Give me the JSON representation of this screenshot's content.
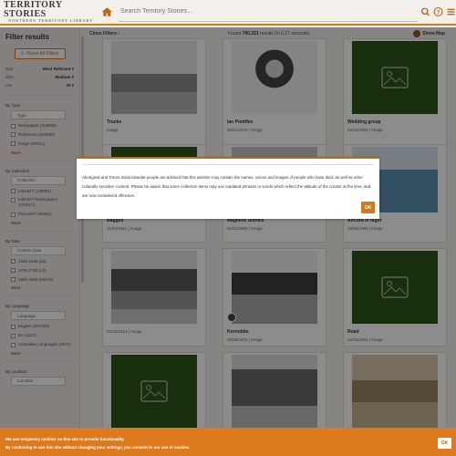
{
  "header": {
    "logo_main": "TERRITORY STORIES",
    "logo_sub": "NORTHERN TERRITORY LIBRARY",
    "search_placeholder": "Search Territory Stories..."
  },
  "sidebar": {
    "title": "Filter results",
    "reset_label": "Reset All Filters",
    "options": [
      {
        "label": "Sort",
        "value": "Most Relevant"
      },
      {
        "label": "Size",
        "value": "Medium"
      },
      {
        "label": "List",
        "value": "20"
      }
    ],
    "facets": [
      {
        "title": "By Type",
        "select": "Type",
        "items": [
          "Newspaper (416806)",
          "Reference (225993)",
          "Image (80821)"
        ],
        "more": "More"
      },
      {
        "title": "By Collection",
        "select": "Collection",
        "items": [
          "IndexNT (129991)",
          "IndexNT Newspapers (102617)",
          "PictureNT (94681)"
        ],
        "more": "More"
      },
      {
        "title": "By Date",
        "select": "Custom Date",
        "items": [
          "1640-1649 (22)",
          "1700-1799 (22)",
          "1800-1899 (66479)"
        ],
        "more": "More"
      },
      {
        "title": "By Language",
        "select": "Language",
        "items": [
          "English (837930)",
          "En (4327)",
          "Australian Languages (2573)"
        ],
        "more": "More"
      },
      {
        "title": "By Location",
        "select": "Location",
        "items": [],
        "more": ""
      }
    ]
  },
  "topbar": {
    "close_filters": "Close Filters",
    "found_prefix": "Found",
    "found_count": "760,321",
    "found_suffix": "results (in 0.27 seconds)",
    "show_map": "Show Map"
  },
  "cards": [
    {
      "title": "Trucks",
      "meta": "Image"
    },
    {
      "title": "Ian Pontifex",
      "meta": "02/01/1976 | Image"
    },
    {
      "title": "Wedding group",
      "meta": "01/01/1993 | Image"
    },
    {
      "title": "Bagged",
      "meta": "11/04/1941 | Image"
    },
    {
      "title": "Magnetic anthills",
      "meta": "01/01/1990 | Image"
    },
    {
      "title": "Aircraft in flight",
      "meta": "18/02/1990 | Image"
    },
    {
      "title": "",
      "meta": "01/01/1915 | Image"
    },
    {
      "title": "Kornnbite",
      "meta": "05/06/1975 | Image"
    },
    {
      "title": "Road",
      "meta": "01/01/1963 | Image"
    },
    {
      "title": "",
      "meta": ""
    },
    {
      "title": "",
      "meta": ""
    },
    {
      "title": "",
      "meta": ""
    }
  ],
  "modal": {
    "text": "Aboriginal and Torres Strait Islander people are advised that this website may contain the names, voices and images of people who have died, as well as other culturally sensitive content. Please be aware that some collection items may use outdated phrases or words which reflect the attitude of the creator at the time, and are now considered offensive.",
    "ok_label": "OK"
  },
  "cookie": {
    "line1": "We use temporary cookies on this site to provide functionality.",
    "line2": "By continuing to use this site without changing your settings, you consent to our use of cookies.",
    "ok_label": "OK"
  },
  "colors": {
    "accent": "#d47a1c",
    "placeholder_green": "#2f5418",
    "cookie_bg": "#dd7a1e"
  }
}
